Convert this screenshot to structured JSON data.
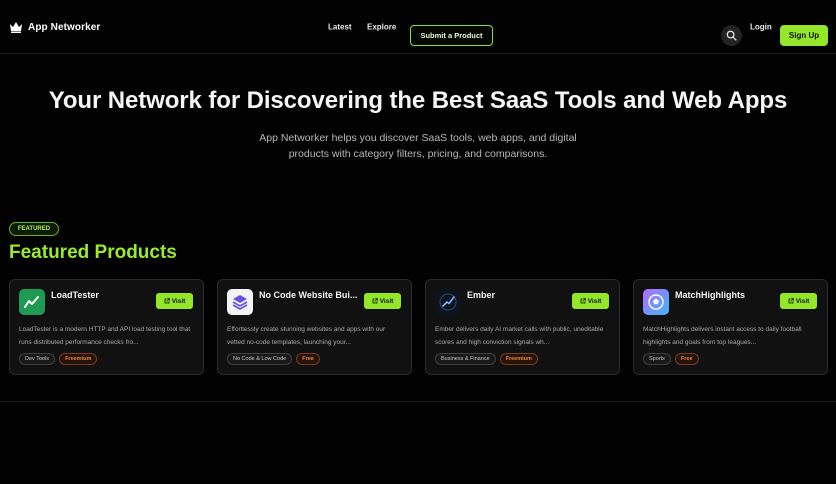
{
  "header": {
    "brand": "App Networker",
    "nav": {
      "latest": "Latest",
      "explore": "Explore"
    },
    "submit_label": "Submit a Product",
    "login_label": "Login",
    "signup_label": "Sign Up"
  },
  "hero": {
    "title": "Your Network for Discovering the Best SaaS Tools and Web Apps",
    "subtitle": "App Networker helps you discover SaaS tools, web apps, and digital products with category filters, pricing, and comparisons."
  },
  "featured": {
    "badge": "FEATURED",
    "title": "Featured Products",
    "products": [
      {
        "name": "LoadTester",
        "visit_label": "Visit",
        "description": "LoadTester is a modern HTTP and API load testing tool that runs distributed performance checks fro...",
        "category": "Dev Tools",
        "pricing": "Freemium",
        "icon": "load-chart-icon"
      },
      {
        "name": "No Code Website Bui...",
        "visit_label": "Visit",
        "description": "Effortlessly create stunning websites and apps with our vetted no-code templates, launching your...",
        "category": "No Code & Low Code",
        "pricing": "Free",
        "icon": "stacked-layers-icon"
      },
      {
        "name": "Ember",
        "visit_label": "Visit",
        "description": "Ember delivers daily AI market calls with public, uneditable scores and high conviction signals wh...",
        "category": "Business & Finance",
        "pricing": "Freemium",
        "icon": "ember-signal-icon"
      },
      {
        "name": "MatchHighlights",
        "visit_label": "Visit",
        "description": "MatchHighlights delivers instant access to daily football highlights and goals from top leagues...",
        "category": "Sports",
        "pricing": "Free",
        "icon": "football-icon"
      }
    ]
  },
  "colors": {
    "accent": "#93e62a",
    "background": "#020203",
    "card": "#111112",
    "pricing_tag": "#f0843c"
  }
}
